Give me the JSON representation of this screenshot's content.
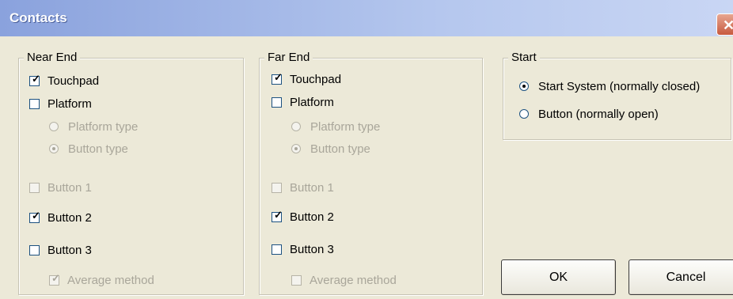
{
  "window": {
    "title": "Contacts",
    "close_glyph": "✕"
  },
  "near_end": {
    "legend": "Near End",
    "touchpad": "Touchpad",
    "platform": "Platform",
    "platform_type": "Platform type",
    "button_type": "Button  type",
    "button1": "Button 1",
    "button2": "Button 2",
    "button3": "Button 3",
    "average_method": "Average method"
  },
  "far_end": {
    "legend": "Far End",
    "touchpad": "Touchpad",
    "platform": "Platform",
    "platform_type": "Platform type",
    "button_type": "Button  type",
    "button1": "Button 1",
    "button2": "Button 2",
    "button3": "Button 3",
    "average_method": "Average method"
  },
  "start": {
    "legend": "Start",
    "start_system": "Start System (normally closed)",
    "button_open": "Button (normally open)"
  },
  "buttons": {
    "ok": "OK",
    "cancel": "Cancel"
  },
  "glyphs": {
    "check": "✓"
  }
}
